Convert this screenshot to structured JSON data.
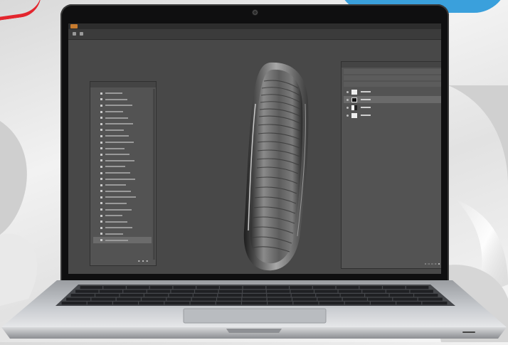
{
  "photo": {
    "accent_colors": {
      "red": "#e3262e",
      "blue": "#3aa0dc"
    },
    "laptop_color": "#c7c9cc"
  },
  "screen": {
    "app_icon": "photoshop-icon",
    "menubar_text": "",
    "options_text": "",
    "history_panel": {
      "title": "",
      "row_count": 25,
      "active_row": 24
    },
    "layers_panel": {
      "tabs": "",
      "layer_count": 4,
      "selected_layer": 1
    }
  }
}
